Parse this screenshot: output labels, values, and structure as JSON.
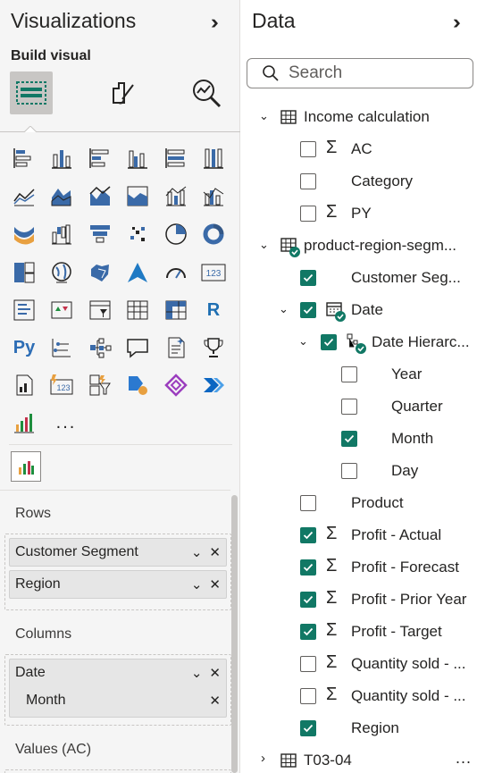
{
  "visualizations": {
    "title": "Visualizations",
    "collapse_icon": "double-chevron-right-icon",
    "build_visual_label": "Build visual",
    "more_visuals_label": "...",
    "wells": {
      "rows_label": "Rows",
      "rows": [
        "Customer Segment",
        "Region"
      ],
      "columns_label": "Columns",
      "columns_field": "Date",
      "columns_subfield": "Month",
      "values_label": "Values (AC)"
    }
  },
  "data": {
    "title": "Data",
    "search_placeholder": "Search",
    "tables": [
      {
        "name": "Income calculation",
        "fields": [
          "AC",
          "Category",
          "PY"
        ]
      },
      {
        "name": "product-region-segm...",
        "fields": [
          "Customer Seg...",
          "Date",
          "Date Hierarc...",
          "Year",
          "Quarter",
          "Month",
          "Day",
          "Product",
          "Profit - Actual",
          "Profit - Forecast",
          "Profit - Prior Year",
          "Profit - Target",
          "Quantity sold - ...",
          "Quantity sold - ...",
          "Region"
        ]
      },
      {
        "name": "T03-04",
        "fields": []
      }
    ],
    "more_label": "..."
  },
  "colors": {
    "accent_check": "#117865",
    "pane_bg": "#f5f5f5"
  }
}
